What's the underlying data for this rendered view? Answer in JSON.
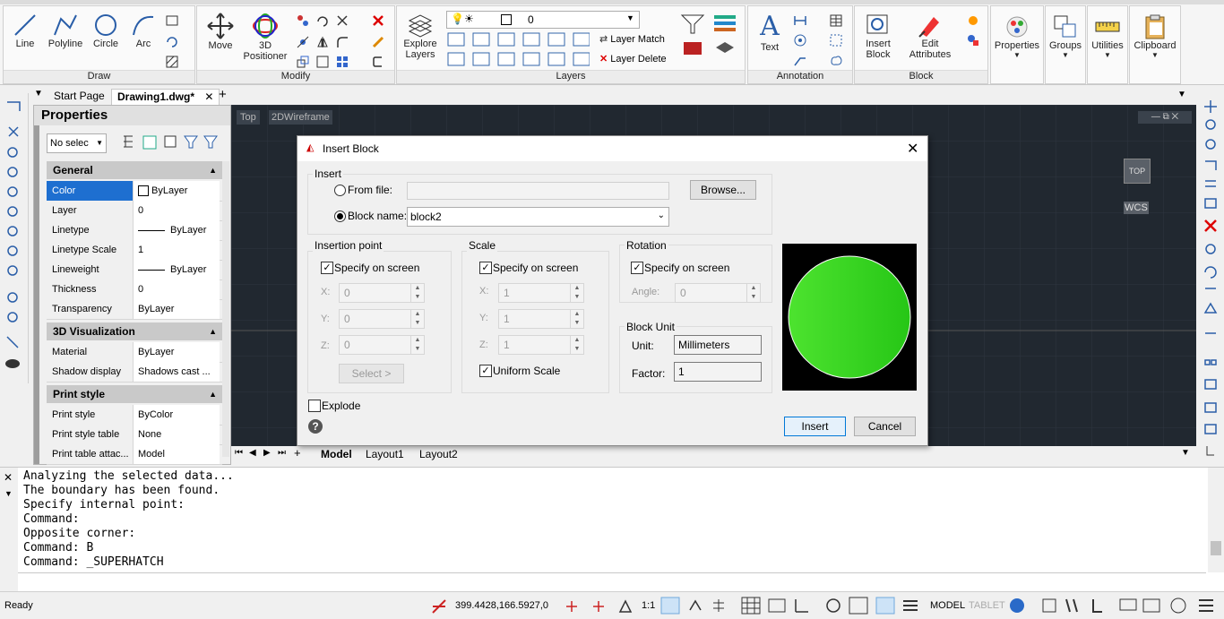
{
  "ribbon": {
    "panels": {
      "draw": "Draw",
      "modify": "Modify",
      "layers": "Layers",
      "annotation": "Annotation",
      "block": "Block"
    },
    "tools": {
      "line": "Line",
      "polyline": "Polyline",
      "circle": "Circle",
      "arc": "Arc",
      "move": "Move",
      "positioner_1": "3D",
      "positioner_2": "Positioner",
      "explore_1": "Explore",
      "explore_2": "Layers",
      "layer_match": "Layer Match",
      "layer_delete": "Layer Delete",
      "layer_value": "0",
      "text": "Text",
      "insert_1": "Insert",
      "insert_2": "Block",
      "edit_1": "Edit",
      "edit_2": "Attributes",
      "properties": "Properties",
      "groups": "Groups",
      "utilities": "Utilities",
      "clipboard": "Clipboard"
    }
  },
  "tabs": {
    "start": "Start Page",
    "drawing": "Drawing1.dwg*"
  },
  "properties": {
    "title": "Properties",
    "selector": "No selec",
    "sections": {
      "general": "General",
      "viz": "3D Visualization",
      "print": "Print style"
    },
    "general": [
      {
        "name": "Color",
        "value": "ByLayer"
      },
      {
        "name": "Layer",
        "value": "0"
      },
      {
        "name": "Linetype",
        "value": "ByLayer"
      },
      {
        "name": "Linetype Scale",
        "value": "1"
      },
      {
        "name": "Lineweight",
        "value": "ByLayer"
      },
      {
        "name": "Thickness",
        "value": "0"
      },
      {
        "name": "Transparency",
        "value": "ByLayer"
      }
    ],
    "viz": [
      {
        "name": "Material",
        "value": "ByLayer"
      },
      {
        "name": "Shadow display",
        "value": "Shadows cast ..."
      }
    ],
    "print": [
      {
        "name": "Print style",
        "value": "ByColor"
      },
      {
        "name": "Print style table",
        "value": "None"
      },
      {
        "name": "Print table attac...",
        "value": "Model"
      }
    ]
  },
  "canvas": {
    "view_top": "Top",
    "view_style": "2DWireframe",
    "cube_top": "TOP",
    "wcs": "WCS",
    "layout_tabs": [
      "Model",
      "Layout1",
      "Layout2"
    ]
  },
  "dialog": {
    "title": "Insert Block",
    "insert_group": "Insert",
    "from_file": "From file:",
    "browse": "Browse...",
    "block_name_label": "Block name:",
    "block_name": "block2",
    "insertion_point": "Insertion point",
    "specify_on_screen": "Specify on screen",
    "x_label": "X:",
    "y_label": "Y:",
    "z_label": "Z:",
    "ins_x": "0",
    "ins_y": "0",
    "ins_z": "0",
    "select_btn": "Select  >",
    "scale": "Scale",
    "scale_x": "1",
    "scale_y": "1",
    "scale_z": "1",
    "uniform_scale": "Uniform Scale",
    "rotation": "Rotation",
    "angle_label": "Angle:",
    "angle": "0",
    "block_unit": "Block Unit",
    "unit_label": "Unit:",
    "unit": "Millimeters",
    "factor_label": "Factor:",
    "factor": "1",
    "explode": "Explode",
    "insert_btn": "Insert",
    "cancel_btn": "Cancel",
    "help": "?"
  },
  "command": {
    "lines": [
      "Analyzing the selected data...",
      "The boundary has been found.",
      "Specify internal point:",
      "Command:",
      "Opposite corner:",
      "Command: B",
      "Command: _SUPERHATCH"
    ]
  },
  "status": {
    "ready": "Ready",
    "coords": "399.4428,166.5927,0",
    "scale": "1:1",
    "model": "MODEL",
    "tablet": "TABLET"
  },
  "colors": {
    "canvas": "#212830",
    "preview_circle": "#33dd22",
    "accent": "#1565c0"
  }
}
